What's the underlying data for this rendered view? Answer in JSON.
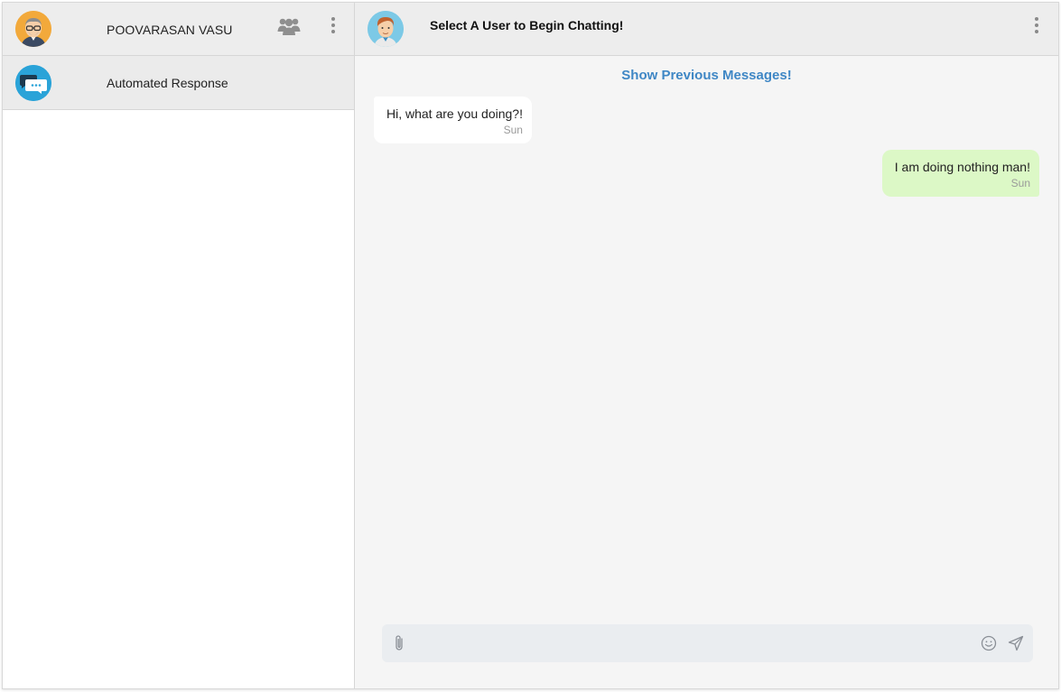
{
  "sidebar": {
    "user_name": "POOVARASAN VASU",
    "header_icons": [
      "group-icon",
      "more-vertical-icon"
    ],
    "conversations": [
      {
        "name": "Automated Response",
        "icon": "chat-bubble-icon"
      }
    ]
  },
  "chat": {
    "title": "Select A User to Begin Chatting!",
    "show_previous": "Show Previous Messages!",
    "messages": [
      {
        "direction": "incoming",
        "text": "Hi, what are you doing?!",
        "time": "Sun"
      },
      {
        "direction": "outgoing",
        "text": "I am doing nothing man!",
        "time": "Sun"
      }
    ],
    "composer": {
      "placeholder": "",
      "value": "",
      "icons": [
        "paperclip-icon",
        "emoji-icon",
        "send-icon"
      ]
    }
  },
  "colors": {
    "link": "#3f87c5",
    "outgoing_bubble": "#dcf8c6",
    "incoming_bubble": "#ffffff",
    "header_bg": "#ededed",
    "chat_bg": "#f5f5f5"
  }
}
